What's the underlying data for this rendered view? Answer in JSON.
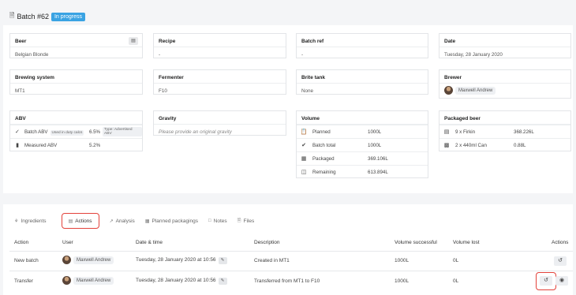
{
  "header": {
    "title": "Batch #62",
    "status": "In progress"
  },
  "cards": {
    "beer": {
      "label": "Beer",
      "value": "Belgian Blonde"
    },
    "recipe": {
      "label": "Recipe",
      "value": "-"
    },
    "batch_ref": {
      "label": "Batch ref",
      "value": "-"
    },
    "date": {
      "label": "Date",
      "value": "Tuesday, 28 January 2020"
    },
    "brewing_system": {
      "label": "Brewing system",
      "value": "MT1"
    },
    "fermenter": {
      "label": "Fermenter",
      "value": "F10"
    },
    "brite_tank": {
      "label": "Brite tank",
      "value": "None"
    },
    "brewer": {
      "label": "Brewer",
      "value": "Maxwell Andrew"
    },
    "abv": {
      "label": "ABV",
      "rows": [
        {
          "label": "Batch ABV",
          "tag": "Used in duty calcs",
          "value": "6.5%",
          "type_tag": "Type: Advertised ABV"
        },
        {
          "label": "Measured ABV",
          "value": "5.2%"
        }
      ]
    },
    "gravity": {
      "label": "Gravity",
      "placeholder": "Please provide an original gravity"
    },
    "volume": {
      "label": "Volume",
      "rows": [
        {
          "label": "Planned",
          "value": "1000L"
        },
        {
          "label": "Batch total",
          "value": "1000L"
        },
        {
          "label": "Packaged",
          "value": "369.106L"
        },
        {
          "label": "Remaining",
          "value": "613.894L"
        }
      ]
    },
    "packaged_beer": {
      "label": "Packaged beer",
      "rows": [
        {
          "label": "9 x Firkin",
          "value": "368.226L"
        },
        {
          "label": "2 x 440ml Can",
          "value": "0.88L"
        }
      ]
    }
  },
  "tabs": [
    {
      "label": "Ingredients"
    },
    {
      "label": "Actions"
    },
    {
      "label": "Analysis"
    },
    {
      "label": "Planned packagings"
    },
    {
      "label": "Notes"
    },
    {
      "label": "Files"
    }
  ],
  "table": {
    "headers": [
      "Action",
      "User",
      "Date & time",
      "Description",
      "Volume successful",
      "Volume lost",
      "Actions"
    ],
    "rows": [
      {
        "action": "New batch",
        "user": "Maxwell Andrew",
        "datetime": "Tuesday, 28 January 2020 at 10:56",
        "description": "Created in MT1",
        "vol_success": "1000L",
        "vol_lost": "0L"
      },
      {
        "action": "Transfer",
        "user": "Maxwell Andrew",
        "datetime": "Tuesday, 28 January 2020 at 10:56",
        "description": "Transferred from MT1 to F10",
        "vol_success": "1000L",
        "vol_lost": "0L"
      }
    ]
  },
  "colors": {
    "status_badge": "#3aa3e3",
    "highlight": "#e3423b"
  }
}
